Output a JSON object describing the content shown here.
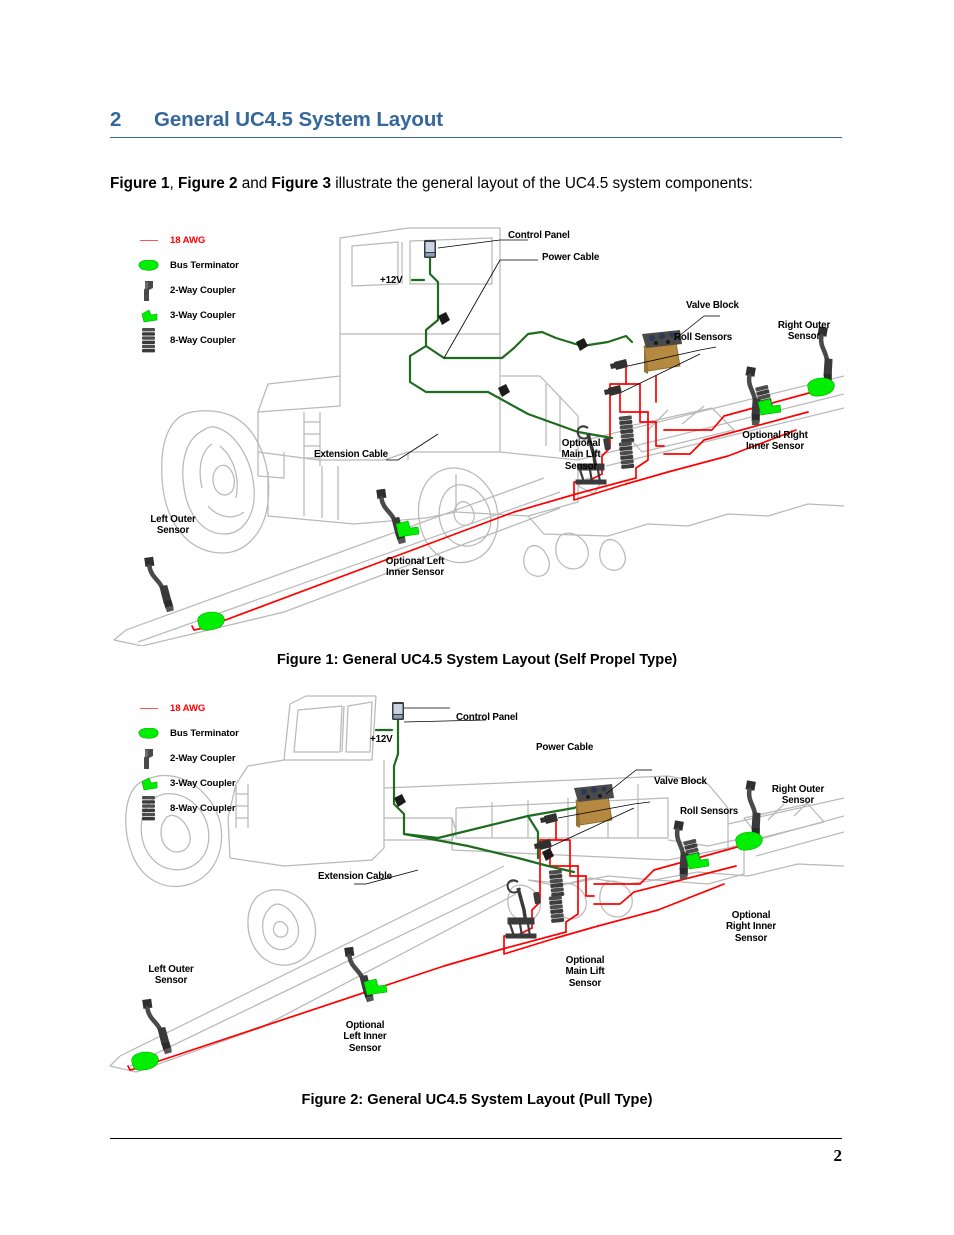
{
  "document": {
    "page_number": "2"
  },
  "section": {
    "number": "2",
    "title": "General UC4.5 System Layout"
  },
  "paragraph": {
    "fig1_ref": "Figure 1",
    "comma": ",",
    "fig2_ref": "Figure 2",
    "and": "and",
    "fig3_ref": "Figure 3",
    "rest": "illustrate the general layout of the UC4.5 system components:"
  },
  "legend": {
    "items": [
      {
        "symbol": "red-wire-line",
        "label": "18 AWG",
        "color": "#ff0000"
      },
      {
        "symbol": "bus-terminator-block",
        "label": "Bus Terminator",
        "color": "#00ee00"
      },
      {
        "symbol": "two-way-coupler-block",
        "label": "2-Way Coupler",
        "color": "#4a4a4a"
      },
      {
        "symbol": "three-way-coupler-block",
        "label": "3-Way Coupler",
        "color": "#00ee00"
      },
      {
        "symbol": "eight-way-coupler-stack",
        "label": "8-Way Coupler",
        "color": "#4a4a4a"
      }
    ]
  },
  "figure1": {
    "caption": "Figure 1: General UC4.5 System Layout (Self Propel Type)",
    "callouts": [
      {
        "name": "control-panel",
        "text": "Control Panel"
      },
      {
        "name": "power-cable",
        "text": "Power Cable"
      },
      {
        "name": "twelve-volt",
        "text": "+12V"
      },
      {
        "name": "valve-block",
        "text": "Valve Block"
      },
      {
        "name": "roll-sensors",
        "text": "Roll Sensors"
      },
      {
        "name": "right-outer-sensor",
        "text": "Right Outer\nSensor"
      },
      {
        "name": "optional-right-inner-sensor",
        "text": "Optional Right\nInner Sensor"
      },
      {
        "name": "extension-cable",
        "text": "Extension Cable"
      },
      {
        "name": "optional-main-lift-sensor",
        "text": "Optional\nMain Lift\nSensor"
      },
      {
        "name": "left-outer-sensor",
        "text": "Left Outer\nSensor"
      },
      {
        "name": "optional-left-inner-sensor",
        "text": "Optional Left\nInner Sensor"
      }
    ]
  },
  "figure2": {
    "caption": "Figure 2: General UC4.5 System Layout (Pull Type)",
    "callouts": [
      {
        "name": "control-panel",
        "text": "Control Panel"
      },
      {
        "name": "power-cable",
        "text": "Power Cable"
      },
      {
        "name": "twelve-volt",
        "text": "+12V"
      },
      {
        "name": "valve-block",
        "text": "Valve Block"
      },
      {
        "name": "roll-sensors",
        "text": "Roll Sensors"
      },
      {
        "name": "right-outer-sensor",
        "text": "Right Outer\nSensor"
      },
      {
        "name": "optional-right-inner-sensor",
        "text": "Optional\nRight Inner\nSensor"
      },
      {
        "name": "extension-cable",
        "text": "Extension Cable"
      },
      {
        "name": "optional-main-lift-sensor",
        "text": "Optional\nMain Lift\nSensor"
      },
      {
        "name": "left-outer-sensor",
        "text": "Left Outer\nSensor"
      },
      {
        "name": "optional-left-inner-sensor",
        "text": "Optional\nLeft Inner\nSensor"
      }
    ]
  },
  "colors": {
    "heading": "#36679B",
    "wire_red": "#ff0000",
    "cable_green": "#1f6b1f",
    "terminator_green": "#00ee00",
    "outline_gray": "#b8b8b8",
    "component_dark": "#3c3c3c",
    "valve_block_tan": "#b5893f"
  }
}
